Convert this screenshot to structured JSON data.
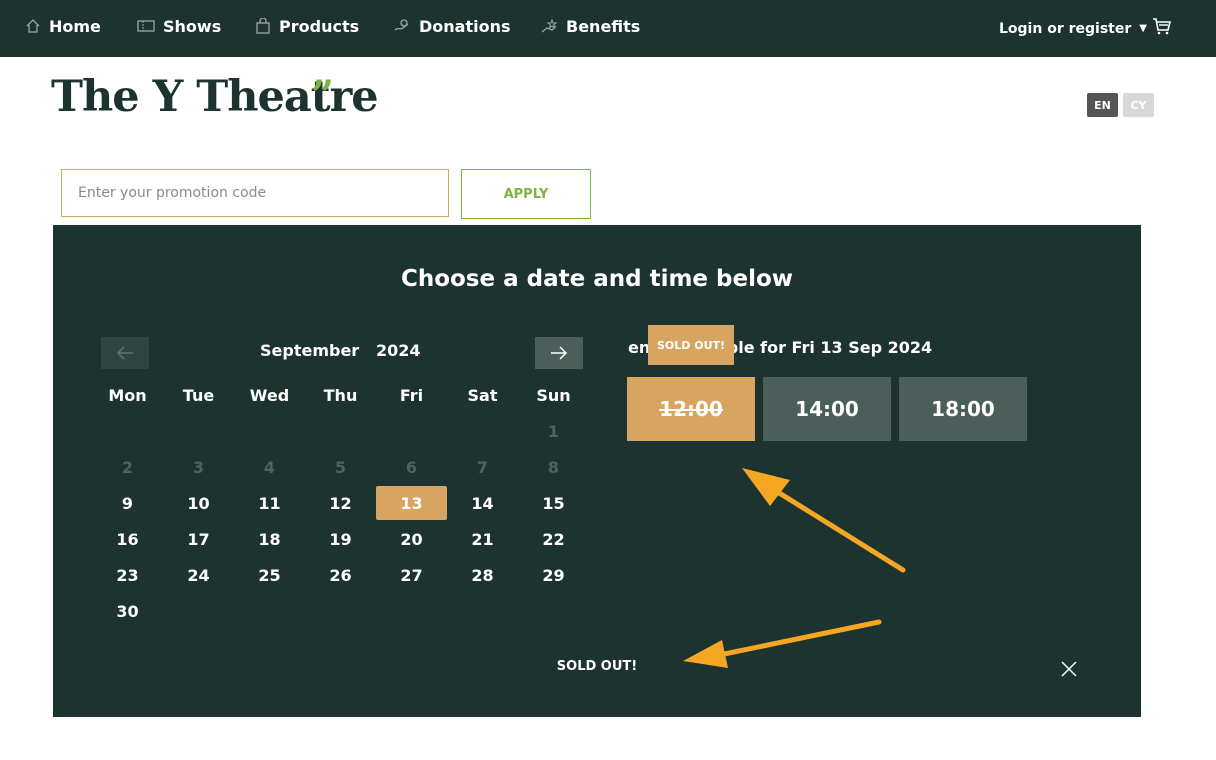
{
  "nav": {
    "items": [
      {
        "label": "Home",
        "icon": "home-icon"
      },
      {
        "label": "Shows",
        "icon": "ticket-icon"
      },
      {
        "label": "Products",
        "icon": "shopping-bag-icon"
      },
      {
        "label": "Donations",
        "icon": "donation-icon"
      },
      {
        "label": "Benefits",
        "icon": "benefits-icon"
      }
    ],
    "login_label": "Login or register",
    "cart_icon": "cart-icon"
  },
  "header": {
    "logo_text": "The Y Theatre",
    "logo_quote": "”",
    "lang_en": "EN",
    "lang_cy": "CY"
  },
  "promo": {
    "placeholder": "Enter your promotion code",
    "apply_label": "APPLY"
  },
  "booking": {
    "title": "Choose a date and time below",
    "month": "September",
    "year": "2024",
    "weekdays": [
      "Mon",
      "Tue",
      "Wed",
      "Thu",
      "Fri",
      "Sat",
      "Sun"
    ],
    "events_label": "ents available for Fri 13 Sep 2024",
    "soldout_badge": "SOLD OUT!",
    "times": [
      "12:00",
      "14:00",
      "18:00"
    ],
    "soldout_text": "SOLD OUT!"
  },
  "colors": {
    "nav_bg": "#1d3330",
    "panel_bg": "#1d3330",
    "accent_gold": "#d8a560",
    "accent_green": "#7cb342",
    "arrow": "#f5a623"
  }
}
